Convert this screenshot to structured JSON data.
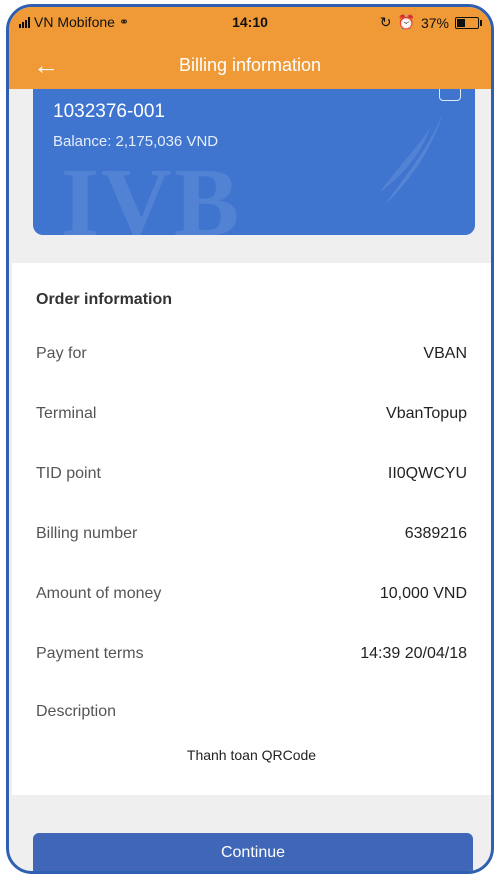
{
  "status_bar": {
    "carrier": "VN Mobifone",
    "time": "14:10",
    "battery": "37%",
    "icons": [
      "signal-icon",
      "wifi-icon",
      "lock-rotation-icon",
      "alarm-icon",
      "battery-icon"
    ]
  },
  "header": {
    "title": "Billing information",
    "back_icon": "arrow-left-icon",
    "color": "#ef9a37"
  },
  "account_card": {
    "account_number": "1032376-001",
    "balance": "Balance: 2,175,036 VND",
    "logo_text": "IVB",
    "color": "#3f74cf"
  },
  "order": {
    "title": "Order information",
    "rows": [
      {
        "label": "Pay for",
        "value": "VBAN"
      },
      {
        "label": "Terminal",
        "value": "VbanTopup"
      },
      {
        "label": "TID point",
        "value": "II0QWCYU"
      },
      {
        "label": "Billing number",
        "value": "6389216"
      },
      {
        "label": "Amount of money",
        "value": "10,000 VND"
      },
      {
        "label": "Payment terms",
        "value": "14:39 20/04/18"
      }
    ]
  },
  "description": {
    "label": "Description",
    "value": "Thanh toan QRCode"
  },
  "actions": {
    "continue_label": "Continue",
    "color": "#3f66b7"
  }
}
